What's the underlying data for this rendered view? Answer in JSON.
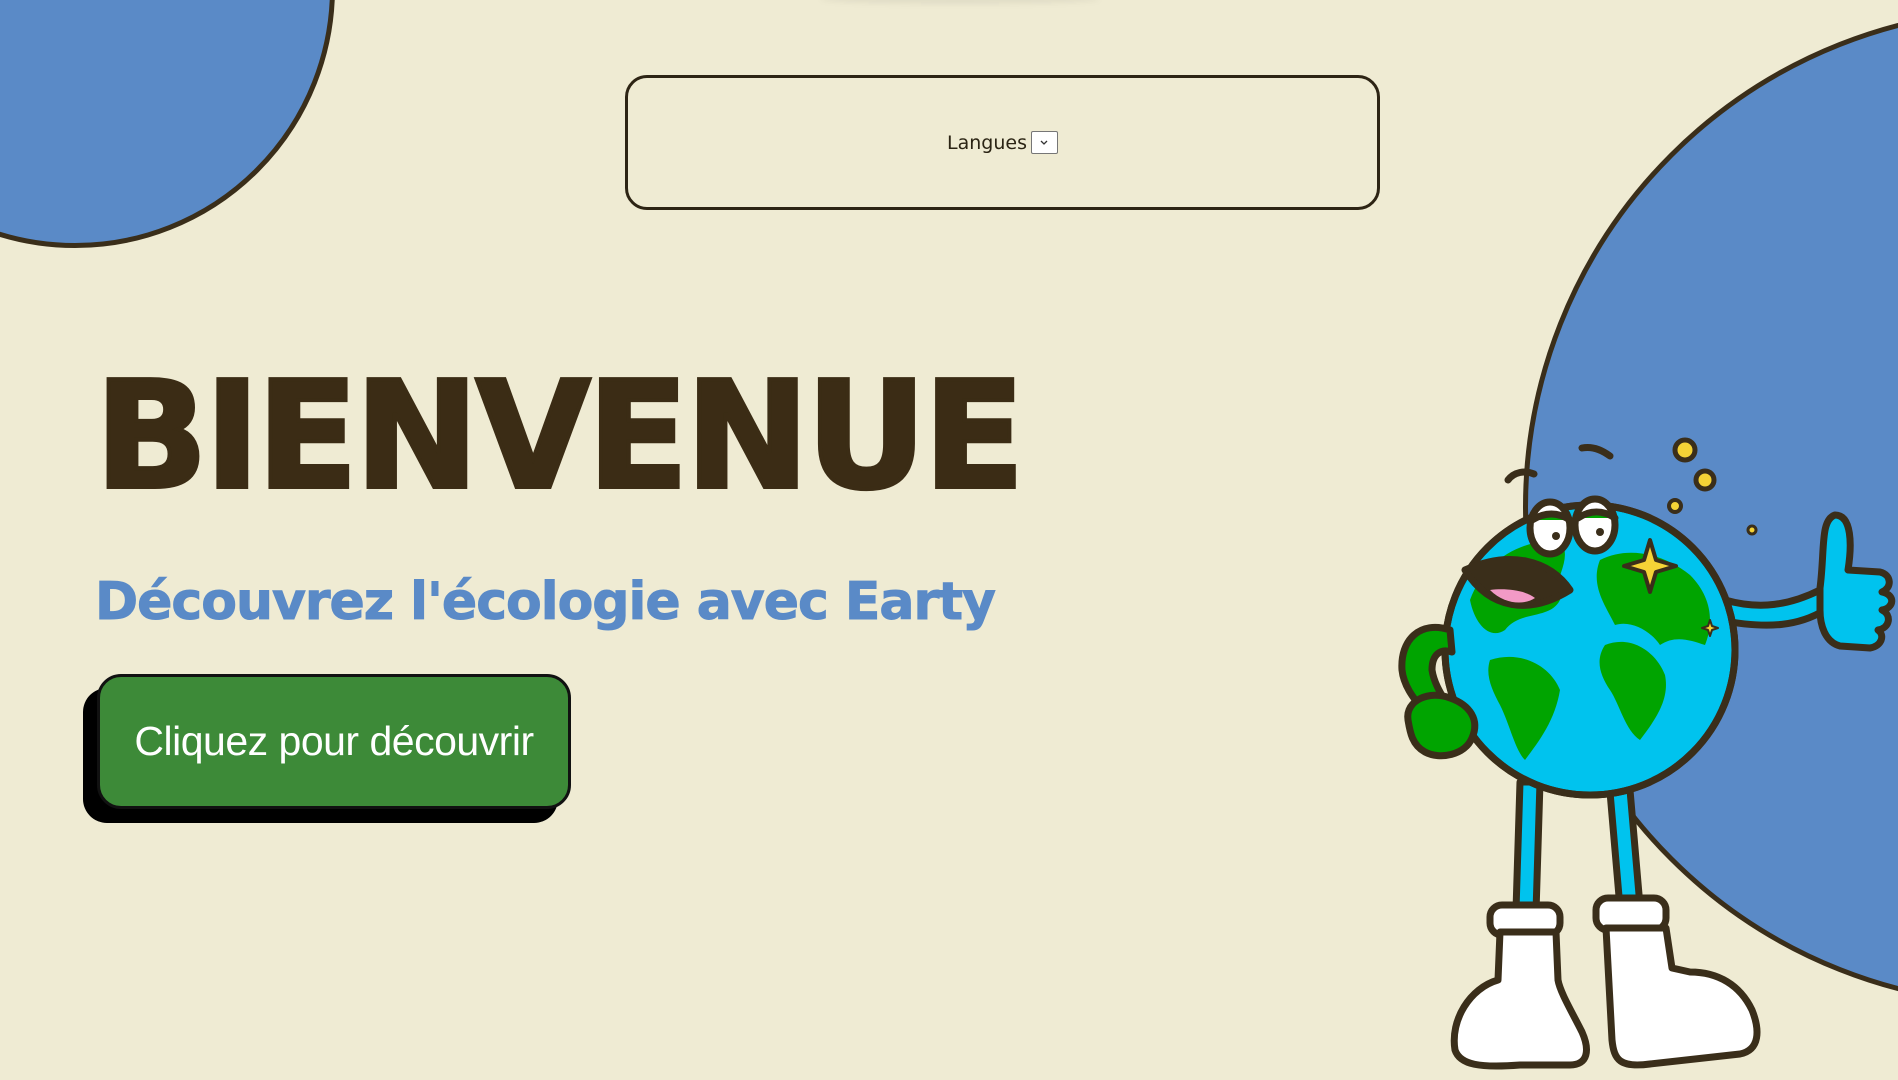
{
  "colors": {
    "background": "#efebd3",
    "blue_blob": "#5a8ac7",
    "outline": "#3a2e1a",
    "title": "#3b2c15",
    "subtitle": "#5a8ac7",
    "cta_background": "#3d8a38",
    "cta_text": "#ffffff",
    "globe_ocean": "#00c3ee",
    "globe_land": "#00a400",
    "sparkle": "#f5d336"
  },
  "language_selector": {
    "label": "Langues",
    "selected": "",
    "icon": "chevron-down-icon"
  },
  "hero": {
    "title": "BIENVENUE",
    "subtitle": "Découvrez l'écologie avec Earty",
    "cta_label": "Cliquez pour découvrir"
  },
  "illustration": {
    "name": "earth-mascot",
    "icon": "earth-globe-thumbs-up"
  }
}
